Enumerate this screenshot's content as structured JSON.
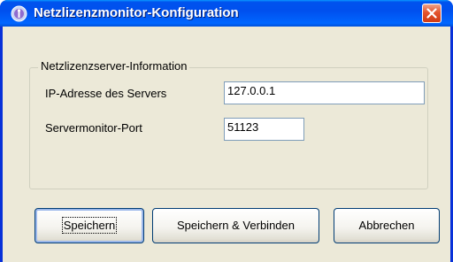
{
  "window": {
    "title": "Netzlizenzmonitor-Konfiguration"
  },
  "icons": {
    "title_icon": "network-license-monitor-icon",
    "close": "close-icon"
  },
  "group": {
    "legend": "Netzlizenzserver-Information",
    "ip_label": "IP-Adresse des Servers",
    "ip_value": "127.0.0.1",
    "port_label": "Servermonitor-Port",
    "port_value": "51123"
  },
  "buttons": {
    "save": "Speichern",
    "save_connect": "Speichern & Verbinden",
    "cancel": "Abbrechen"
  },
  "colors": {
    "titlebar": "#0053ee",
    "client": "#ece9d8",
    "close_button": "#e3542d"
  }
}
